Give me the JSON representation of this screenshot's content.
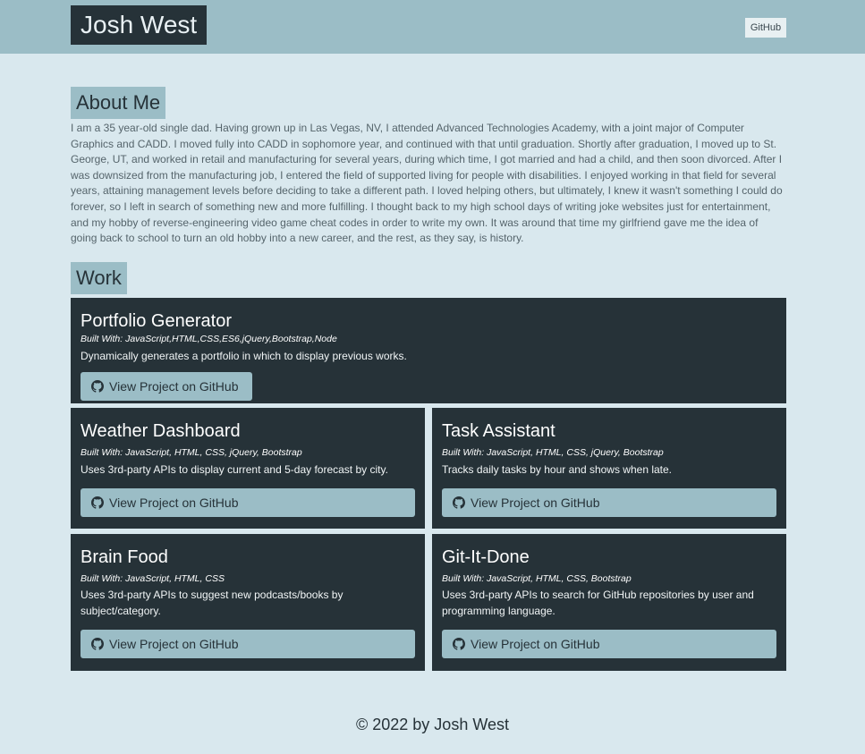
{
  "header": {
    "brand": "Josh West",
    "github_link": "GitHub"
  },
  "about": {
    "title": "About Me",
    "text": "I am a 35 year-old single dad. Having grown up in Las Vegas, NV, I attended Advanced Technologies Academy, with a joint major of Computer Graphics and CADD. I moved fully into CADD in sophomore year, and continued with that until graduation. Shortly after graduation, I moved up to St. George, UT, and worked in retail and manufacturing for several years, during which time, I got married and had a child, and then soon divorced. After I was downsized from the manufacturing job, I entered the field of supported living for people with disabilities. I enjoyed working in that field for several years, attaining management levels before deciding to take a different path. I loved helping others, but ultimately, I knew it wasn't something I could do forever, so I left in search of something new and more fulfilling. I thought back to my high school days of writing joke websites just for entertainment, and my hobby of reverse-engineering video game cheat codes in order to write my own. It was around that time my girlfriend gave me the idea of going back to school to turn an old hobby into a new career, and the rest, as they say, is history."
  },
  "work": {
    "title": "Work",
    "button_label": "View Project on GitHub",
    "button_icon": "github-icon",
    "projects": [
      {
        "title": "Portfolio Generator",
        "built_with": "Built With: JavaScript,HTML,CSS,ES6,jQuery,Bootstrap,Node",
        "description": "Dynamically generates a portfolio in which to display previous works."
      },
      {
        "title": "Weather Dashboard",
        "built_with": "Built With: JavaScript, HTML, CSS, jQuery, Bootstrap",
        "description": "Uses 3rd-party APIs to display current and 5-day forecast by city."
      },
      {
        "title": "Task Assistant",
        "built_with": "Built With: JavaScript, HTML, CSS, jQuery, Bootstrap",
        "description": "Tracks daily tasks by hour and shows when late."
      },
      {
        "title": "Brain Food",
        "built_with": "Built With: JavaScript, HTML, CSS",
        "description": "Uses 3rd-party APIs to suggest new podcasts/books by subject/category."
      },
      {
        "title": "Git-It-Done",
        "built_with": "Built With: JavaScript, HTML, CSS, Bootstrap",
        "description": "Uses 3rd-party APIs to search for GitHub repositories by user and programming language."
      }
    ]
  },
  "footer": {
    "text": "© 2022 by Josh West"
  },
  "colors": {
    "page_background": "#d9e8ee",
    "accent": "#9bbdc6",
    "card_background": "#263238"
  }
}
